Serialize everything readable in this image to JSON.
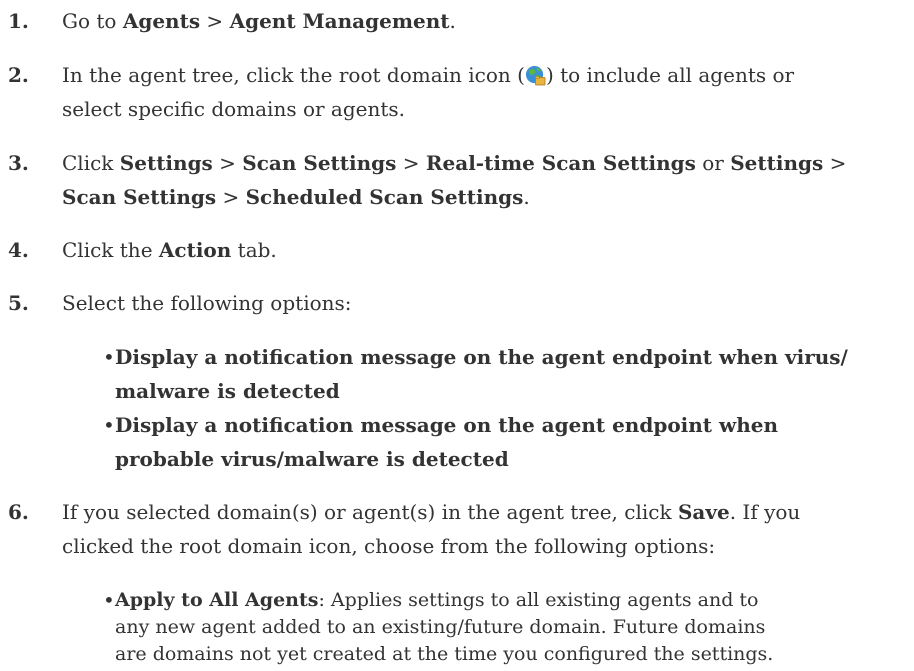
{
  "steps": {
    "s1": {
      "num": "1.",
      "t1": "Go to ",
      "b1": "Agents",
      "t2": " > ",
      "b2": "Agent Management",
      "t3": "."
    },
    "s2": {
      "num": "2.",
      "l1_pre": "In the agent tree, click the root domain icon (",
      "l1_post": ") to include all agents or",
      "l2": "select specific domains or agents."
    },
    "s3": {
      "num": "3.",
      "l1_t1": "Click ",
      "l1_b1": "Settings",
      "l1_t2": " > ",
      "l1_b2": "Scan Settings",
      "l1_t3": " > ",
      "l1_b3": "Real-time Scan Settings",
      "l1_t4": " or ",
      "l1_b4": "Settings",
      "l1_t5": " >",
      "l2_b1": "Scan Settings",
      "l2_t1": " > ",
      "l2_b2": "Scheduled Scan Settings",
      "l2_t2": "."
    },
    "s4": {
      "num": "4.",
      "t1": "Click the ",
      "b1": "Action",
      "t2": " tab."
    },
    "s5": {
      "num": "5.",
      "text": "Select the following options:",
      "bullets": [
        {
          "l1": "Display a notification message on the agent endpoint when virus/",
          "l2": "malware is detected"
        },
        {
          "l1": "Display a notification message on the agent endpoint when",
          "l2": "probable virus/malware is detected"
        }
      ]
    },
    "s6": {
      "num": "6.",
      "l1_t1": "If you selected domain(s) or agent(s) in the agent tree, click ",
      "l1_b1": "Save",
      "l1_t2": ". If you",
      "l2": "clicked the root domain icon, choose from the following options:",
      "bullet": {
        "b1": "Apply to All Agents",
        "l1": ": Applies settings to all existing agents and to",
        "l2": "any new agent added to an existing/future domain. Future domains",
        "l3": "are domains not yet created at the time you configured the settings."
      }
    }
  },
  "bullet_char": "•",
  "icon": "root-domain-globe-icon"
}
